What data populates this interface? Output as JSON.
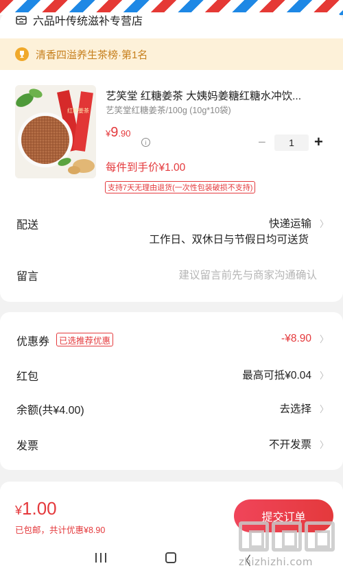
{
  "shop": {
    "name": "六品叶传统滋补专营店",
    "icon": "shop-icon"
  },
  "rank": {
    "text": "清香四溢养生茶榜·第1名",
    "icon": "trophy-icon"
  },
  "product": {
    "title": "艺笑堂 红糖姜茶 大姨妈姜糖红糖水冲饮...",
    "spec": "艺笑堂红糖姜茶/100g (10g*10袋)",
    "price_symbol": "¥",
    "price_int": "9",
    "price_dec": ".90",
    "info_icon": "ⓘ",
    "quantity": "1",
    "minus": "−",
    "plus": "+",
    "final_price": "每件到手价¥1.00",
    "return_policy": "支持7天无理由退货(一次性包装破损不支持)",
    "pack_text": "红糖姜茶"
  },
  "delivery": {
    "label": "配送",
    "method": "快递运输",
    "note": "工作日、双休日与节假日均可送货"
  },
  "remark": {
    "label": "留言",
    "placeholder": "建议留言前先与商家沟通确认"
  },
  "discounts": {
    "coupon_label": "优惠券",
    "coupon_badge": "已选推荐优惠",
    "coupon_value": "-¥8.90",
    "redpacket_label": "红包",
    "redpacket_value": "最高可抵¥0.04",
    "balance_label": "余额(共¥4.00)",
    "balance_value": "去选择",
    "invoice_label": "发票",
    "invoice_value": "不开发票"
  },
  "footer": {
    "total_symbol": "¥",
    "total_value": "1.00",
    "total_sub": "已包邮，共计优惠¥8.90",
    "submit_label": "提交订单"
  },
  "watermark": {
    "url": "zhizhizhi.com"
  },
  "colors": {
    "accent": "#e4393c",
    "banner_bg": "#fdf1d9",
    "banner_text": "#c7801e"
  }
}
